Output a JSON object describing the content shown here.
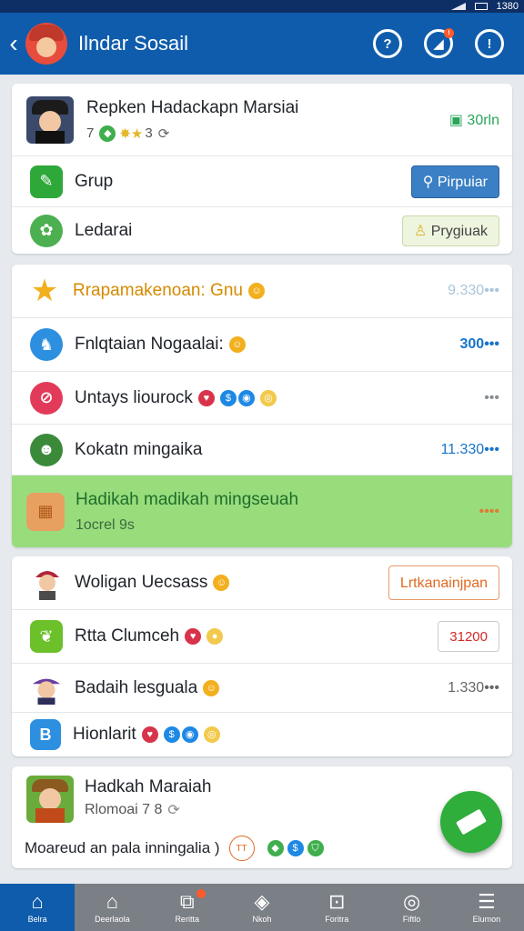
{
  "status": {
    "time": "1380"
  },
  "appbar": {
    "title": "Ilndar Sosail",
    "back_icon": "chevron-left-icon"
  },
  "profile": {
    "name": "Repken Hadackapn Marsiai",
    "meta_num1": "7",
    "meta_num2": "3",
    "balance": "30rln"
  },
  "group_rows": [
    {
      "label": "Grup",
      "button": "Pirpuiar",
      "icon_color": "#2fa83a"
    },
    {
      "label": "Ledarai",
      "button": "Prygiuak",
      "icon_color": "#4caf50"
    }
  ],
  "list_rows": [
    {
      "label": "Rrapamakenoan: Gnu",
      "value": "9.330•••",
      "label_color": "#d68a00",
      "value_color": "#a9c6da"
    },
    {
      "label": "Fnlqtaian Nogaalai:",
      "value": "300•••",
      "label_color": "#1f2329",
      "value_color": "#1774c9"
    },
    {
      "label": "Untays liourock",
      "value": "•••",
      "label_color": "#1f2329",
      "value_color": "#8a8f95"
    },
    {
      "label": "Kokatn mingaika",
      "value": "11.330•••",
      "label_color": "#1f2329",
      "value_color": "#1774c9"
    }
  ],
  "highlight": {
    "title": "Hadikah madikah mingseuah",
    "subtitle": "1ocrel 9s",
    "value": "••••"
  },
  "friends": [
    {
      "label": "Woligan Uecsass",
      "action": "Lrtkanainjpan",
      "action_type": "button"
    },
    {
      "label": "Rtta Clumceh",
      "action": "31200",
      "action_type": "badge"
    },
    {
      "label": "Badaih lesguala",
      "action": "1.330•••",
      "action_type": "text"
    },
    {
      "label": "Hionlarit",
      "action": "",
      "action_type": "none"
    }
  ],
  "post": {
    "name": "Hadkah Maraiah",
    "meta": "Rlomoai 7 8",
    "text": "Moareud an pala inningalia )"
  },
  "nav": [
    {
      "label": "Belra",
      "icon": "home-outline-icon",
      "glyph": "⌂",
      "active": true
    },
    {
      "label": "Deerlaola",
      "icon": "home-icon",
      "glyph": "⌂",
      "active": false
    },
    {
      "label": "Reritta",
      "icon": "chat-icon",
      "glyph": "⧉",
      "active": false,
      "badge": true
    },
    {
      "label": "Nkoh",
      "icon": "layers-icon",
      "glyph": "◈",
      "active": false
    },
    {
      "label": "Foritra",
      "icon": "shop-icon",
      "glyph": "⊡",
      "active": false
    },
    {
      "label": "Fiftlo",
      "icon": "circle-icon",
      "glyph": "◎",
      "active": false
    },
    {
      "label": "Elumon",
      "icon": "menu-icon",
      "glyph": "☰",
      "active": false
    }
  ]
}
